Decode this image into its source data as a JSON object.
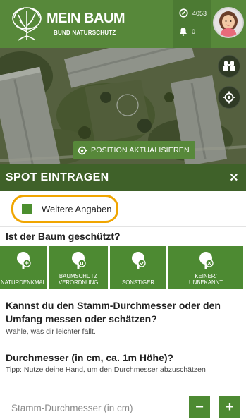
{
  "header": {
    "title": "MEIN BAUM",
    "subtitle": "BUND NATURSCHUTZ",
    "points": "4053",
    "notifications": "0",
    "brand_color": "#57883a"
  },
  "map": {
    "position_button_label": "POSITION AKTUALISIEREN",
    "icons": [
      "binoculars-icon",
      "locate-icon"
    ]
  },
  "spot": {
    "title": "SPOT EINTRAGEN",
    "close_label": "×"
  },
  "form": {
    "weitere_label": "Weitere Angaben",
    "protected_question": "Ist der Baum geschützt?",
    "protection_options": [
      {
        "label": "NATURDENKMAL"
      },
      {
        "label": "BAUMSCHUTZ VERORDNUNG"
      },
      {
        "label": "SONSTIGER"
      },
      {
        "label": "KEINER/ UNBEKANNT"
      }
    ],
    "measure_question": "Kannst du den Stamm-Durchmesser oder den Umfang messen oder schätzen?",
    "measure_hint": "Wähle, was dir leichter fällt.",
    "diameter_question": "Durchmesser (in cm, ca. 1m Höhe)?",
    "diameter_hint": "Tipp: Nutze deine Hand, um den Durchmesser abzuschätzen",
    "diameter_placeholder": "Stamm-Durchmesser (in cm)",
    "minus_label": "−",
    "plus_label": "+"
  }
}
